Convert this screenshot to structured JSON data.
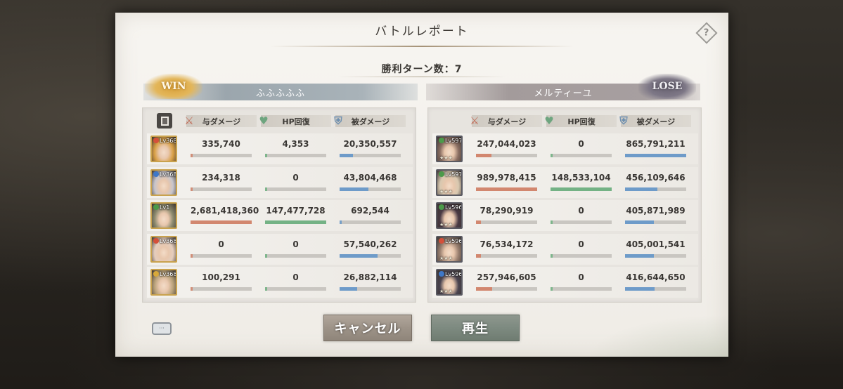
{
  "dialog": {
    "title": "バトルレポート",
    "turns_label": "勝利ターン数：7",
    "cancel_label": "キャンセル",
    "play_label": "再生",
    "help_icon": "question-diamond-icon",
    "chat_icon": "chat-bubble-icon"
  },
  "columns": {
    "damage_dealt": "与ダメージ",
    "hp_recovery": "HP回復",
    "damage_taken": "被ダメージ"
  },
  "left_team": {
    "result": "WIN",
    "name": "ふふふふふ",
    "members": [
      {
        "level": "Lv368",
        "element": "fire",
        "damage": "335,740",
        "heal": "4,353",
        "taken": "20,350,557",
        "damage_ratio": 0.0,
        "heal_ratio": 0.0,
        "taken_ratio": 0.22
      },
      {
        "level": "Lv368",
        "element": "water",
        "damage": "234,318",
        "heal": "0",
        "taken": "43,804,468",
        "damage_ratio": 0.0,
        "heal_ratio": 0.0,
        "taken_ratio": 0.47
      },
      {
        "level": "Lv1",
        "element": "wind",
        "damage": "2,681,418,360",
        "heal": "147,477,728",
        "taken": "692,544",
        "damage_ratio": 1.0,
        "heal_ratio": 1.0,
        "taken_ratio": 0.0
      },
      {
        "level": "Lv368",
        "element": "fire",
        "damage": "0",
        "heal": "0",
        "taken": "57,540,262",
        "damage_ratio": 0.0,
        "heal_ratio": 0.0,
        "taken_ratio": 0.62
      },
      {
        "level": "Lv368",
        "element": "light",
        "damage": "100,291",
        "heal": "0",
        "taken": "26,882,114",
        "damage_ratio": 0.0,
        "heal_ratio": 0.0,
        "taken_ratio": 0.29
      }
    ]
  },
  "right_team": {
    "result": "LOSE",
    "name": "メルティーユ",
    "members": [
      {
        "level": "Lv597",
        "element": "wind",
        "damage": "247,044,023",
        "heal": "0",
        "taken": "865,791,211",
        "damage_ratio": 0.25,
        "heal_ratio": 0.0,
        "taken_ratio": 1.0
      },
      {
        "level": "Lv597",
        "element": "wind",
        "damage": "989,978,415",
        "heal": "148,533,104",
        "taken": "456,109,646",
        "damage_ratio": 1.0,
        "heal_ratio": 1.0,
        "taken_ratio": 0.53
      },
      {
        "level": "Lv596",
        "element": "wind",
        "damage": "78,290,919",
        "heal": "0",
        "taken": "405,871,989",
        "damage_ratio": 0.08,
        "heal_ratio": 0.0,
        "taken_ratio": 0.47
      },
      {
        "level": "Lv596",
        "element": "fire",
        "damage": "76,534,172",
        "heal": "0",
        "taken": "405,001,541",
        "damage_ratio": 0.08,
        "heal_ratio": 0.0,
        "taken_ratio": 0.47
      },
      {
        "level": "Lv596",
        "element": "water",
        "damage": "257,946,605",
        "heal": "0",
        "taken": "416,644,650",
        "damage_ratio": 0.26,
        "heal_ratio": 0.0,
        "taken_ratio": 0.48
      }
    ]
  },
  "colors": {
    "damage_bar": "#d2876f",
    "heal_bar": "#74b285",
    "taken_bar": "#6e9bc9",
    "element_fire": "#d4503a",
    "element_water": "#3f78c8",
    "element_wind": "#4c9a4a",
    "element_light": "#d7a83a"
  }
}
